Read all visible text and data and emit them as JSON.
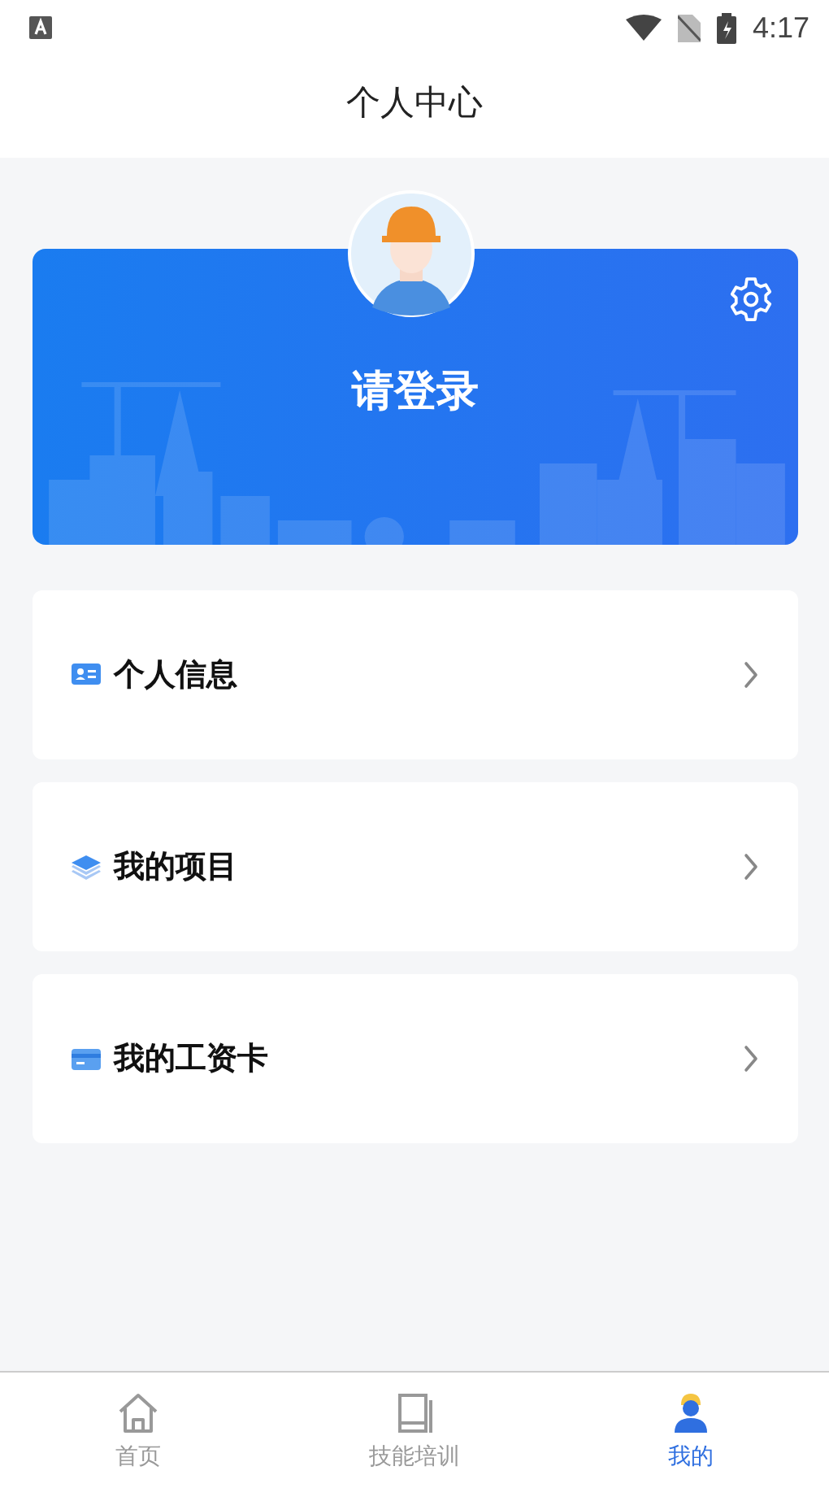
{
  "status_bar": {
    "time": "4:17"
  },
  "header": {
    "title": "个人中心"
  },
  "profile": {
    "login_label": "请登录"
  },
  "menu": [
    {
      "label": "个人信息",
      "kind": "id-card"
    },
    {
      "label": "我的项目",
      "kind": "layers"
    },
    {
      "label": "我的工资卡",
      "kind": "card"
    }
  ],
  "tabs": [
    {
      "label": "首页",
      "kind": "home",
      "selected": false
    },
    {
      "label": "技能培训",
      "kind": "book",
      "selected": false
    },
    {
      "label": "我的",
      "kind": "user",
      "selected": true
    }
  ]
}
